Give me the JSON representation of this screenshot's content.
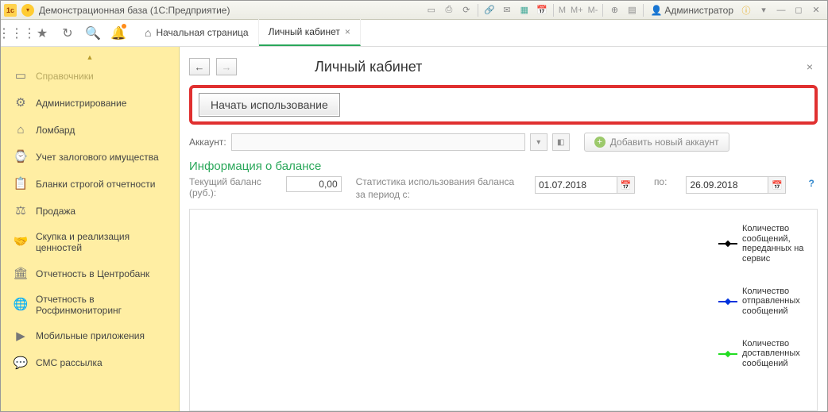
{
  "window": {
    "title": "Демонстрационная база  (1С:Предприятие)"
  },
  "user": {
    "name": "Администратор"
  },
  "titlebar_icons": {
    "m": "M",
    "mplus": "M+",
    "mminus": "M-"
  },
  "tabs": {
    "home": "Начальная страница",
    "active": "Личный кабинет"
  },
  "sidebar": {
    "items": [
      {
        "label": "Справочники",
        "dim": true
      },
      {
        "label": "Администрирование"
      },
      {
        "label": "Ломбард"
      },
      {
        "label": "Учет залогового имущества"
      },
      {
        "label": "Бланки строгой отчетности"
      },
      {
        "label": "Продажа"
      },
      {
        "label": "Скупка и реализация ценностей"
      },
      {
        "label": "Отчетность в Центробанк"
      },
      {
        "label": "Отчетность в Росфинмониторинг"
      },
      {
        "label": "Мобильные приложения"
      },
      {
        "label": "СМС рассылка"
      }
    ]
  },
  "page": {
    "title": "Личный кабинет",
    "start_button": "Начать использование",
    "account_label": "Аккаунт:",
    "add_account": "Добавить новый аккаунт",
    "balance_section": "Информация о балансе",
    "current_balance_label": "Текущий баланс (руб.):",
    "current_balance_value": "0,00",
    "stats_label": "Статистика использования баланса за период с:",
    "date_from": "01.07.2018",
    "po": "по:",
    "date_to": "26.09.2018",
    "help": "?"
  },
  "legend": {
    "l1": "Количество сообщений, переданных на сервис",
    "l2": "Количество отправленных сообщений",
    "l3": "Количество доставленных сообщений"
  },
  "chart_data": {
    "type": "line",
    "title": "",
    "xlabel": "",
    "ylabel": "",
    "x": [],
    "series": [
      {
        "name": "Количество сообщений, переданных на сервис",
        "values": [],
        "color": "#000000"
      },
      {
        "name": "Количество отправленных сообщений",
        "values": [],
        "color": "#0033dd"
      },
      {
        "name": "Количество доставленных сообщений",
        "values": [],
        "color": "#22dd22"
      }
    ]
  }
}
